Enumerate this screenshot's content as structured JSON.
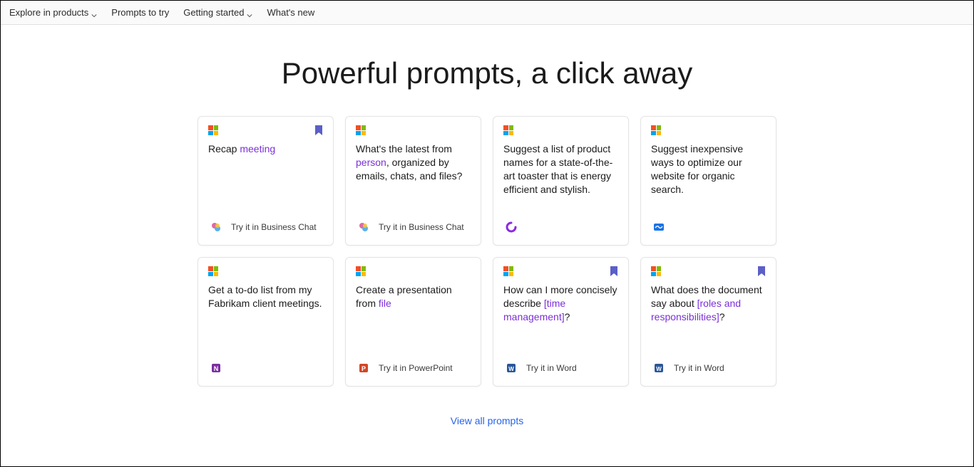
{
  "nav": {
    "explore": "Explore in products",
    "prompts": "Prompts to try",
    "getting_started": "Getting started",
    "whats_new": "What's new"
  },
  "hero": {
    "title": "Powerful prompts, a click away"
  },
  "cards": [
    {
      "prefix": "Recap ",
      "highlight": "meeting",
      "suffix": "",
      "bookmarked": true,
      "app": "copilot",
      "foot_label": "Try it in Business Chat"
    },
    {
      "prefix": "What's the latest from ",
      "highlight": "person",
      "suffix": ", organized by emails, chats, and files?",
      "bookmarked": false,
      "app": "copilot",
      "foot_label": "Try it in Business Chat"
    },
    {
      "prefix": "Suggest a list of product names for a state-of-the-art toaster that is energy efficient and stylish.",
      "highlight": "",
      "suffix": "",
      "bookmarked": false,
      "app": "loop",
      "foot_label": ""
    },
    {
      "prefix": "Suggest inexpensive ways to optimize our website for organic search.",
      "highlight": "",
      "suffix": "",
      "bookmarked": false,
      "app": "whiteboard",
      "foot_label": ""
    },
    {
      "prefix": "Get a to-do list from my Fabrikam client meetings.",
      "highlight": "",
      "suffix": "",
      "bookmarked": false,
      "app": "onenote",
      "foot_label": ""
    },
    {
      "prefix": "Create a presentation from ",
      "highlight": "file",
      "suffix": "",
      "bookmarked": false,
      "app": "powerpoint",
      "foot_label": "Try it in PowerPoint"
    },
    {
      "prefix": "How can I more concisely describe ",
      "highlight": "[time management]",
      "suffix": "?",
      "bookmarked": true,
      "app": "word",
      "foot_label": "Try it in Word"
    },
    {
      "prefix": "What does the document say about ",
      "highlight": "[roles and responsibilities]",
      "suffix": "?",
      "bookmarked": true,
      "app": "word",
      "foot_label": "Try it in Word"
    }
  ],
  "view_all": "View all prompts",
  "icons": {
    "copilot": "copilot-icon",
    "loop": "loop-icon",
    "whiteboard": "whiteboard-icon",
    "onenote": "onenote-icon",
    "powerpoint": "powerpoint-icon",
    "word": "word-icon"
  }
}
